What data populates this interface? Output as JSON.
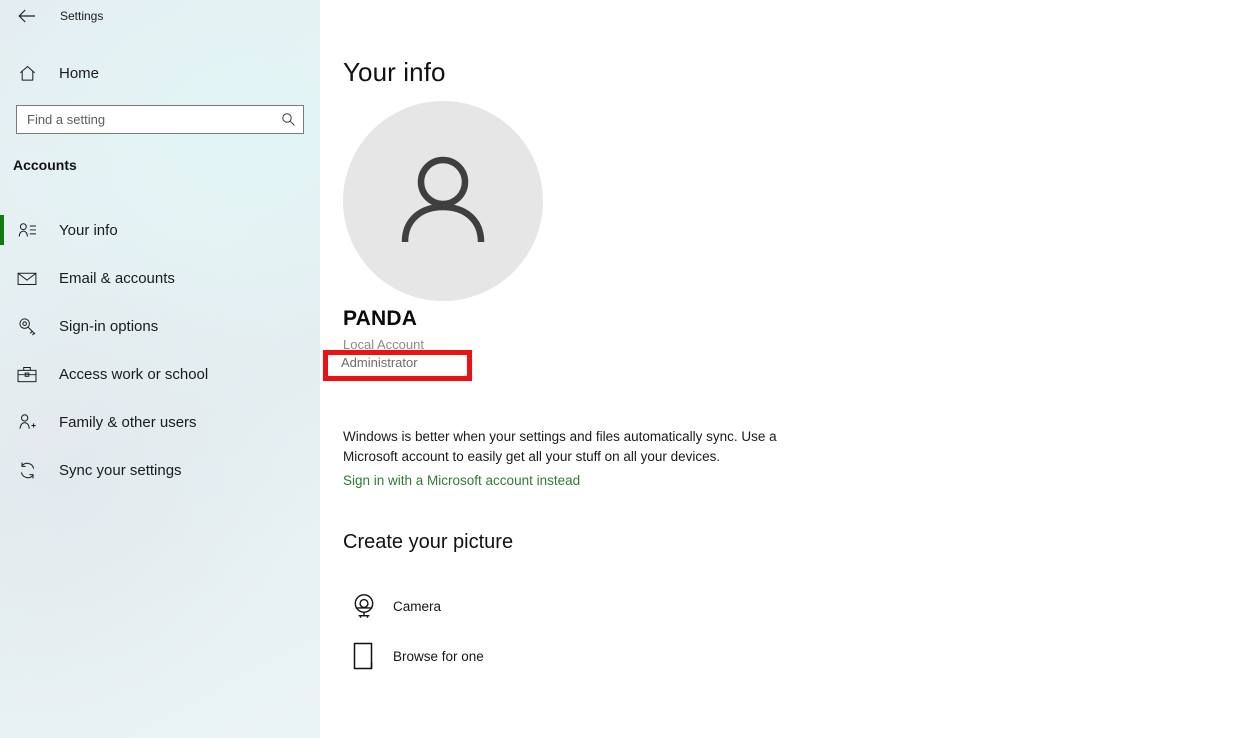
{
  "window": {
    "title": "Settings",
    "back_icon": "back-arrow-icon"
  },
  "sidebar": {
    "home": {
      "label": "Home",
      "icon": "home-icon"
    },
    "search": {
      "placeholder": "Find a setting",
      "value": "",
      "icon": "search-icon"
    },
    "group_heading": "Accounts",
    "items": [
      {
        "label": "Your info",
        "icon": "user-info-icon",
        "selected": true
      },
      {
        "label": "Email & accounts",
        "icon": "envelope-icon",
        "selected": false
      },
      {
        "label": "Sign-in options",
        "icon": "key-icon",
        "selected": false
      },
      {
        "label": "Access work or school",
        "icon": "briefcase-icon",
        "selected": false
      },
      {
        "label": "Family & other users",
        "icon": "user-add-icon",
        "selected": false
      },
      {
        "label": "Sync your settings",
        "icon": "sync-icon",
        "selected": false
      }
    ]
  },
  "main": {
    "page_title": "Your info",
    "avatar_icon": "person-avatar-icon",
    "account": {
      "name": "PANDA",
      "type": "Local Account",
      "role": "Administrator"
    },
    "sync_description": "Windows is better when your settings and files automatically sync. Use a Microsoft account to easily get all your stuff on all your devices.",
    "microsoft_link": "Sign in with a Microsoft account instead",
    "picture_section": {
      "heading": "Create your picture",
      "options": [
        {
          "label": "Camera",
          "icon": "webcam-icon"
        },
        {
          "label": "Browse for one",
          "icon": "file-browse-icon"
        }
      ]
    }
  },
  "annotation": {
    "highlight_target": "Administrator",
    "color": "#ee1111"
  },
  "colors": {
    "accent_green": "#107c10",
    "link_green": "#2f7d32",
    "highlight_red": "#ee1111",
    "avatar_bg": "#e6e6e6",
    "sidebar_bg": "#e6f1f3"
  }
}
